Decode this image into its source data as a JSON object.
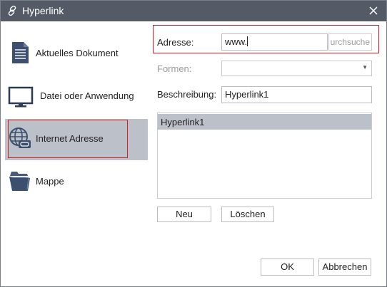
{
  "window": {
    "title": "Hyperlink",
    "title_icon": "link-icon",
    "close_icon": "close-icon"
  },
  "sidebar": {
    "items": [
      {
        "label": "Aktuelles Dokument",
        "icon": "document-icon",
        "selected": false
      },
      {
        "label": "Datei oder Anwendung",
        "icon": "monitor-icon",
        "selected": false
      },
      {
        "label": "Internet Adresse",
        "icon": "globe-icon",
        "selected": true
      },
      {
        "label": "Mappe",
        "icon": "folder-icon",
        "selected": false
      }
    ]
  },
  "form": {
    "address_label": "Adresse:",
    "address_value": "www.",
    "browse_label": "Durchsuchen",
    "browse_visible_text": "urchsuche",
    "formen_label": "Formen:",
    "formen_value": "",
    "description_label": "Beschreibung:",
    "description_value": "Hyperlink1"
  },
  "list": {
    "items": [
      "Hyperlink1"
    ]
  },
  "buttons": {
    "new": "Neu",
    "delete": "Löschen",
    "ok": "OK",
    "cancel": "Abbrechen"
  },
  "colors": {
    "titlebar": "#555b66",
    "selection": "#bcc0c9",
    "highlight_outline": "#d0202a"
  }
}
